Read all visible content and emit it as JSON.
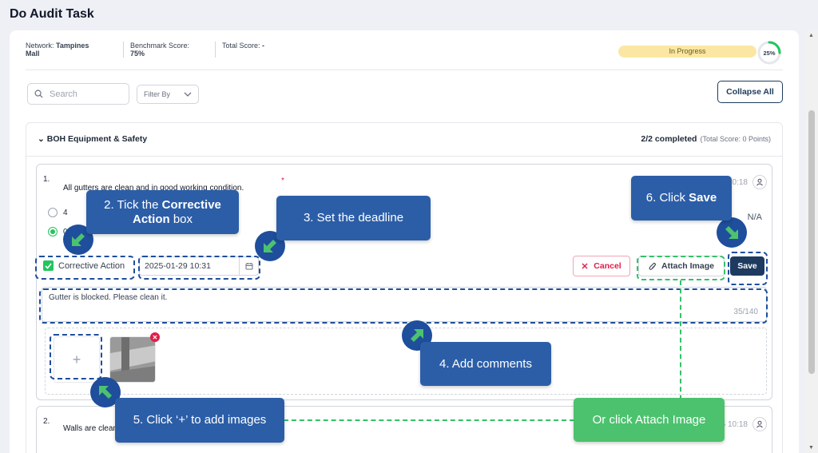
{
  "page_title": "Do Audit Task",
  "header": {
    "network_label": "Network:",
    "network_value_line1": "Tampines",
    "network_value_line2": "Mall",
    "benchmark_label": "Benchmark Score:",
    "benchmark_value": "75%",
    "total_label": "Total Score:",
    "total_value": "-",
    "status": "In Progress",
    "progress_text": "25%",
    "progress_value": 0.25
  },
  "toolbar": {
    "search_placeholder": "Search",
    "filter_label": "Filter By",
    "collapse_label": "Collapse All"
  },
  "section": {
    "chevron": "⌄",
    "title": "BOH Equipment & Safety",
    "completed": "2/2 completed",
    "total_score": "(Total Score: 0 Points)"
  },
  "question1": {
    "number": "1.",
    "text": "All gutters are clean and in good working condition.",
    "required_mark": "*",
    "date": "29 Jan 25 10:18",
    "option_a": "4",
    "option_b": "0",
    "na_label": "N/A",
    "corrective_label": "Corrective Action",
    "deadline": "2025-01-29 10:31",
    "cancel_label": "Cancel",
    "attach_label": "Attach Image",
    "save_label": "Save",
    "comment": "Gutter is blocked. Please clean it.",
    "char_count": "35/140",
    "add_tile": "+"
  },
  "question2": {
    "number": "2.",
    "text": "Walls are clean and in good condition.",
    "date": "29 Jan 25 10:18"
  },
  "callouts": {
    "step2_prefix": "2. Tick the ",
    "step2_bold": "Corrective Action",
    "step2_suffix": " box",
    "step3": "3. Set the deadline",
    "step4": "4. Add comments",
    "step5": "5. Click ‘+’ to add images",
    "step6_prefix": "6. Click ",
    "step6_bold": "Save",
    "or_attach": "Or click Attach Image"
  },
  "colors": {
    "callout_blue": "#2c5ea8",
    "callout_green": "#4cc26e",
    "save_button": "#1e3a5f",
    "status_pill": "#fbe7a3"
  }
}
